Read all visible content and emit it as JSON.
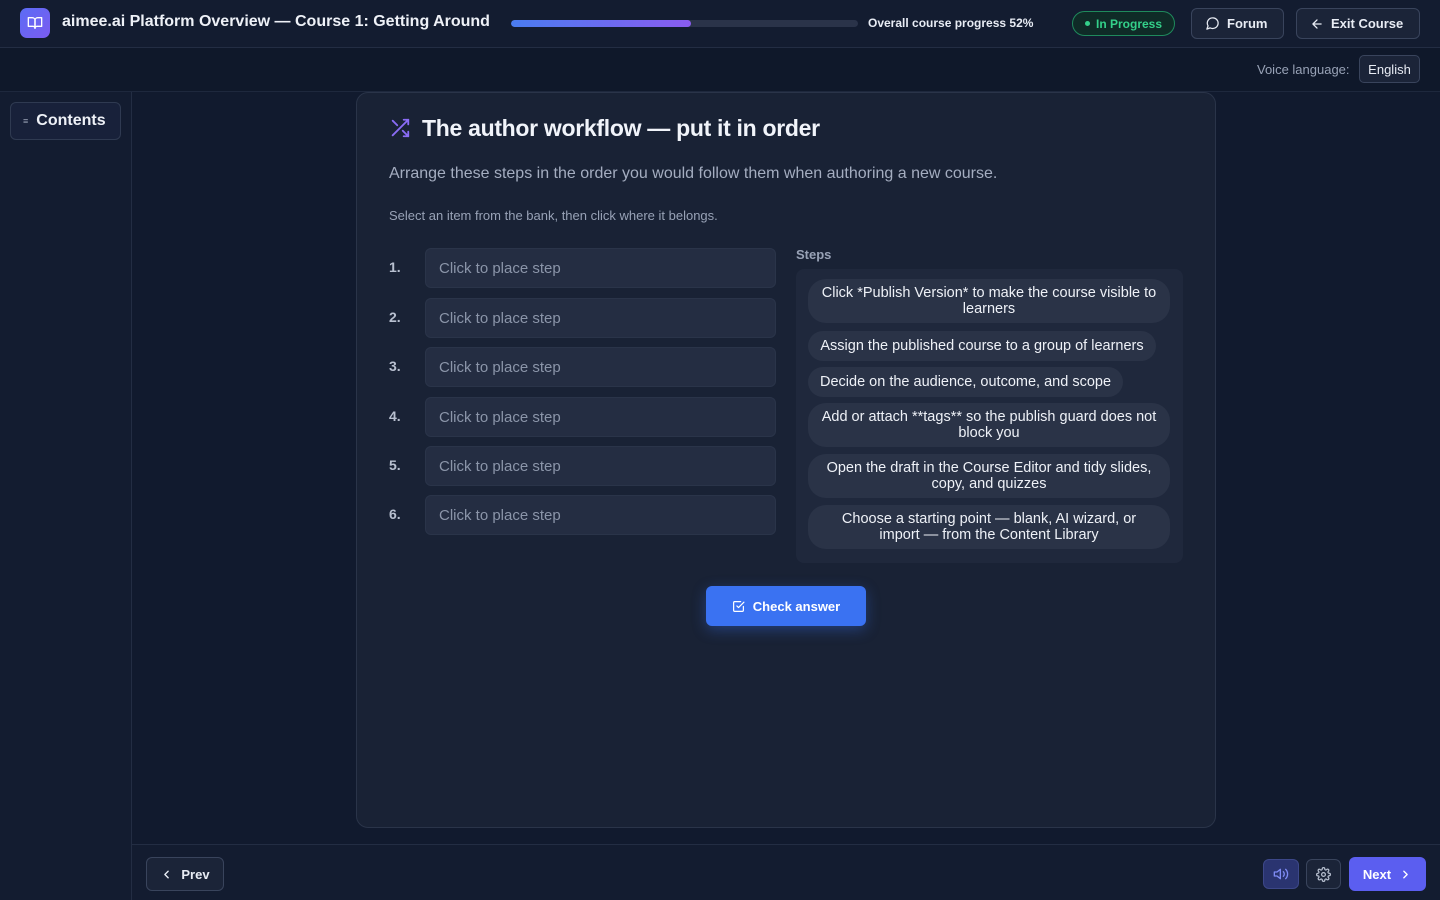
{
  "header": {
    "title": "aimee.ai Platform Overview — Course 1: Getting Around",
    "progress_value": 0.52,
    "progress_text": "Overall course progress 52%",
    "status": "In Progress",
    "forum_label": "Forum",
    "exit_label": "Exit Course",
    "logo_icon": "book-open-icon"
  },
  "subbar": {
    "voice_label": "Voice language:",
    "voice_value": "English"
  },
  "sidebar": {
    "contents_label": "Contents",
    "contents_icon": "list-icon"
  },
  "activity": {
    "title_icon": "shuffle-icon",
    "title": "The author workflow — put it in order",
    "description": "Arrange these steps in the order you would follow them when authoring a new course.",
    "hint": "Select an item from the bank, then click where it belongs.",
    "slots": [
      {
        "number": "1.",
        "placeholder": "Click to place step"
      },
      {
        "number": "2.",
        "placeholder": "Click to place step"
      },
      {
        "number": "3.",
        "placeholder": "Click to place step"
      },
      {
        "number": "4.",
        "placeholder": "Click to place step"
      },
      {
        "number": "5.",
        "placeholder": "Click to place step"
      },
      {
        "number": "6.",
        "placeholder": "Click to place step"
      }
    ],
    "steps_label": "Steps",
    "steps": [
      "Click *Publish Version* to make the course visible to learners",
      "Assign the published course to a group of learners",
      "Decide on the audience, outcome, and scope",
      "Add or attach **tags** so the publish guard does not block you",
      "Open the draft in the Course Editor and tidy slides, copy, and quizzes",
      "Choose a starting point — blank, AI wizard, or import — from the Content Library"
    ],
    "check_label": "Check answer",
    "check_icon": "check-square-icon"
  },
  "footer": {
    "prev_label": "Prev",
    "next_label": "Next",
    "audio_icon": "speaker-icon",
    "settings_icon": "gear-icon"
  },
  "colors": {
    "background": "#111a2e",
    "accent": "#3a72f2",
    "next_button": "#5b5ef0",
    "status_green": "#34d08a"
  }
}
